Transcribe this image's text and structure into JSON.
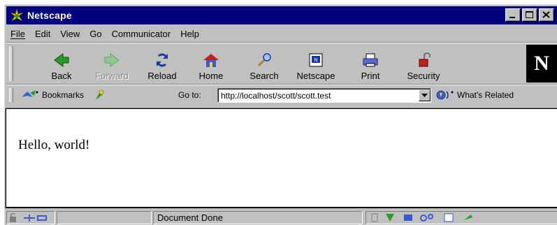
{
  "window": {
    "title": "Netscape",
    "title_bar_color": "#00007f"
  },
  "menu": [
    {
      "label": "File",
      "hotkey": "F"
    },
    {
      "label": "Edit",
      "hotkey": "E"
    },
    {
      "label": "View",
      "hotkey": "V"
    },
    {
      "label": "Go",
      "hotkey": "G"
    },
    {
      "label": "Communicator",
      "hotkey": "C"
    },
    {
      "label": "Help",
      "hotkey": "H"
    }
  ],
  "toolbar": {
    "back": "Back",
    "forward": "Forward",
    "reload": "Reload",
    "home": "Home",
    "search": "Search",
    "netscape": "Netscape",
    "print": "Print",
    "security": "Security",
    "logo": "N"
  },
  "location": {
    "bookmarks_label": "Bookmarks",
    "goto_label": "Go to:",
    "url": "http://localhost/scott/scott.test",
    "related_label": "What's Related"
  },
  "content": {
    "text": "Hello, world!"
  },
  "status": {
    "text": "Document Done"
  }
}
